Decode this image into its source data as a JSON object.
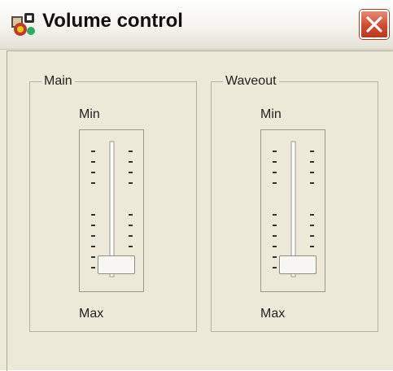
{
  "window": {
    "title": "Volume control"
  },
  "titlebar": {
    "app_icon": "speaker-mixer-icon",
    "close_icon": "close-x-icon"
  },
  "groups": [
    {
      "label": "Main",
      "min_label": "Min",
      "max_label": "Max",
      "level": 0.92
    },
    {
      "label": "Waveout",
      "min_label": "Min",
      "max_label": "Max",
      "level": 0.92
    }
  ],
  "colors": {
    "window_bg": "#ece9d8",
    "close_button": "#cf4b2e"
  }
}
